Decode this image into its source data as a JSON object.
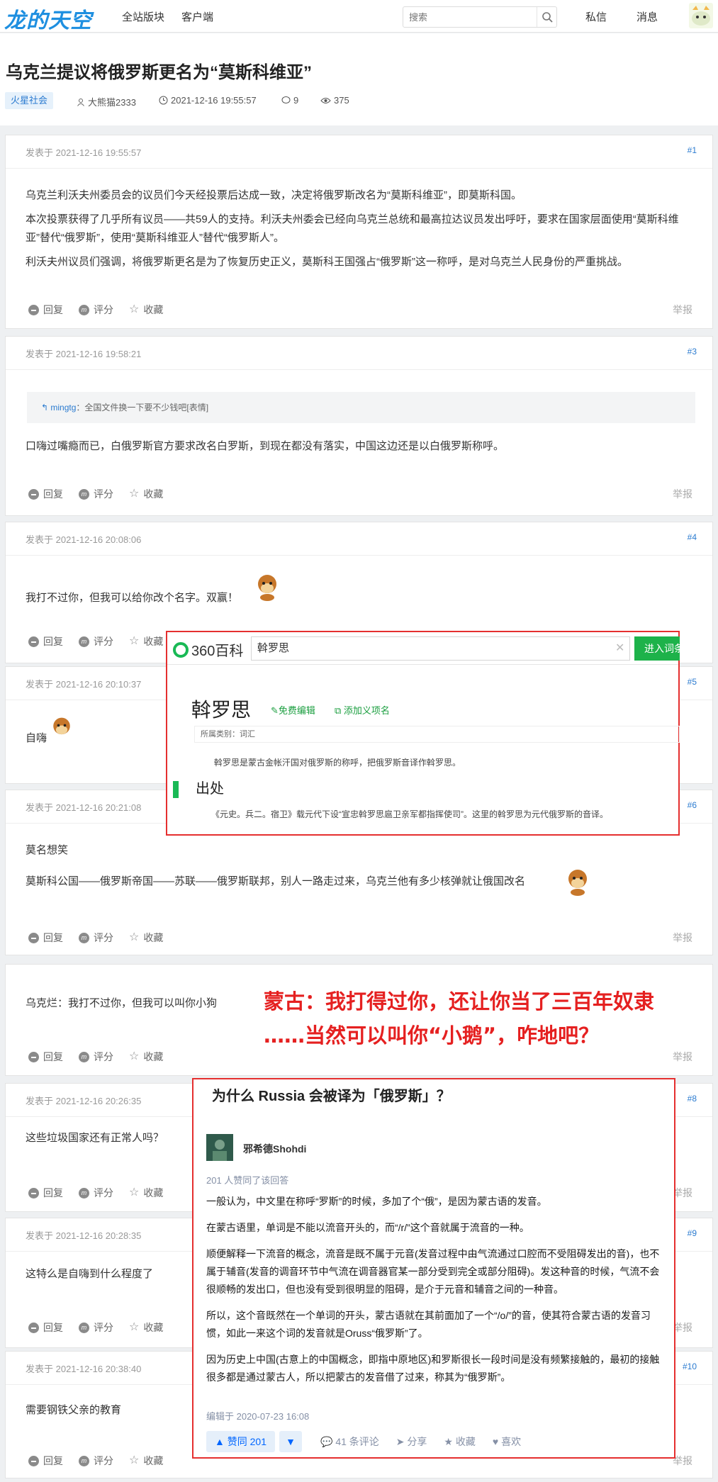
{
  "header": {
    "logo": "龙的天空",
    "nav": [
      "全站版块",
      "客户端"
    ],
    "search_placeholder": "搜索",
    "right": [
      "私信",
      "消息"
    ]
  },
  "thread": {
    "title": "乌克兰提议将俄罗斯更名为“莫斯科维亚”",
    "tag": "火星社会",
    "author": "大熊猫2333",
    "datetime": "2021-12-16 19:55:57",
    "replies": "9",
    "views": "375"
  },
  "actions": {
    "reply": "回复",
    "rate": "评分",
    "fav": "收藏",
    "report": "举报"
  },
  "posts": [
    {
      "time": "发表于 2021-12-16 19:55:57",
      "num": "#1",
      "paras": [
        "乌克兰利沃夫州委员会的议员们今天经投票后达成一致，决定将俄罗斯改名为“莫斯科维亚”，即莫斯科国。",
        "本次投票获得了几乎所有议员——共59人的支持。利沃夫州委会已经向乌克兰总统和最高拉达议员发出呼吁，要求在国家层面使用“莫斯科维亚”替代“俄罗斯”，使用“莫斯科维亚人”替代“俄罗斯人”。",
        "利沃夫州议员们强调，将俄罗斯更名是为了恢复历史正义，莫斯科王国强占“俄罗斯”这一称呼，是对乌克兰人民身份的严重挑战。"
      ]
    },
    {
      "time": "发表于 2021-12-16 19:58:21",
      "num": "#3",
      "quote_user": "mingtg",
      "quote_text": "：全国文件换一下要不少钱吧[表情]",
      "text": "口嗨过嘴瘾而已，白俄罗斯官方要求改名白罗斯，到现在都没有落实，中国这边还是以白俄罗斯称呼。"
    },
    {
      "time": "发表于 2021-12-16 20:08:06",
      "num": "#4",
      "text": "我打不过你，但我可以给你改个名字。双赢！"
    },
    {
      "time": "发表于 2021-12-16 20:10:37",
      "num": "#5",
      "text": "自嗨"
    },
    {
      "time": "发表于 2021-12-16 20:21:08",
      "num": "#6",
      "text": "莫名想笑",
      "text2": "莫斯科公国——俄罗斯帝国——苏联——俄罗斯联邦，别人一路走过来，乌克兰他有多少核弹就让俄国改名"
    },
    {
      "text": "乌克烂：我打不过你，但我可以叫你小狗"
    },
    {
      "time": "发表于 2021-12-16 20:26:35",
      "num": "#8",
      "text": "这些垃圾国家还有正常人吗？"
    },
    {
      "time": "发表于 2021-12-16 20:28:35",
      "num": "#9",
      "text": "这特么是自嗨到什么程度了"
    },
    {
      "time": "发表于 2021-12-16 20:38:40",
      "num": "#10",
      "text": "需要钢铁父亲的教育"
    }
  ],
  "baike": {
    "logo": "360百科",
    "query": "斡罗思",
    "enter": "进入词条",
    "headword": "斡罗思",
    "edit": "免费编辑",
    "add": "添加义项名",
    "category": "所属类别：词汇",
    "desc": "斡罗思是蒙古金帐汗国对俄罗斯的称呼，把俄罗斯音译作斡罗思。",
    "section": "出处",
    "source": "《元史。兵二。宿卫》载元代下设“宣忠斡罗思扈卫亲军都指挥使司”。这里的斡罗思为元代俄罗斯的音译。"
  },
  "annotation": {
    "line1": "蒙古：我打得过你，还让你当了三百年奴隶",
    "line2": "……当然可以叫你“小鹅”，咋地吧？"
  },
  "zhihu": {
    "title": "为什么 Russia 会被译为「俄罗斯」？",
    "author": "邪希德Shohdi",
    "likes": "201 人赞同了该回答",
    "paras": [
      "一般认为，中文里在称呼“罗斯”的时候，多加了个“俄”，是因为蒙古语的发音。",
      "在蒙古语里，单词是不能以流音开头的，而“/r/”这个音就属于流音的一种。",
      "顺便解释一下流音的概念，流音是既不属于元音(发音过程中由气流通过口腔而不受阻碍发出的音)，也不属于辅音(发音的调音环节中气流在调音器官某一部分受到完全或部分阻碍)。发这种音的时候，气流不会很顺畅的发出口，但也没有受到很明显的阻碍，是介于元音和辅音之间的一种音。",
      "所以，这个音既然在一个单词的开头，蒙古语就在其前面加了一个“/o/”的音，使其符合蒙古语的发音习惯，如此一来这个词的发音就是Oruss“俄罗斯”了。",
      "因为历史上中国(古意上的中国概念，即指中原地区)和罗斯很长一段时间是没有频繁接触的，最初的接触很多都是通过蒙古人，所以把蒙古的发音借了过来，称其为“俄罗斯”。"
    ],
    "edited": "编辑于 2020-07-23 16:08",
    "upvote": "▲ 赞同 201",
    "comments": "41 条评论",
    "share": "分享",
    "fav": "收藏",
    "like": "喜欢"
  },
  "colors": {
    "accent": "#2b7bd0",
    "annotation": "#e52020",
    "baike_green": "#19b955"
  }
}
